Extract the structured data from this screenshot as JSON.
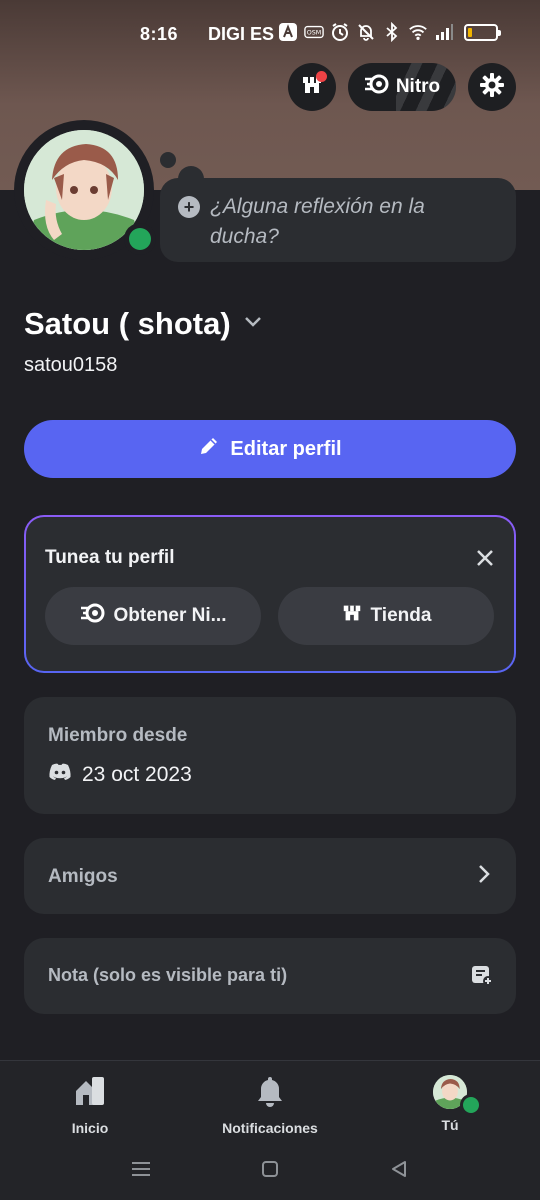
{
  "status_bar": {
    "time": "8:16",
    "carrier": "DIGI ES",
    "icons": [
      "app-a-icon",
      "osm-icon",
      "alarm-icon",
      "mute-icon",
      "bluetooth-icon",
      "wifi-icon",
      "signal-icon",
      "battery-icon"
    ]
  },
  "header": {
    "nitro_label": "Nitro",
    "icons": [
      "shop-icon",
      "nitro-icon",
      "gear-icon"
    ],
    "notification_color": "#ed4245"
  },
  "profile": {
    "display_name": "Satou ( shota)",
    "username": "satou0158",
    "status": "online",
    "status_color": "#23a55a",
    "thought_placeholder": "¿Alguna reflexión en la ducha?"
  },
  "edit_profile": {
    "label": "Editar perfil",
    "color": "#5865f2"
  },
  "tune_card": {
    "title": "Tunea tu perfil",
    "nitro_button": "Obtener Ni...",
    "shop_button": "Tienda"
  },
  "member_since": {
    "label": "Miembro desde",
    "date": "23 oct 2023"
  },
  "friends": {
    "label": "Amigos"
  },
  "note": {
    "label": "Nota (solo es visible para ti)"
  },
  "bottom_nav": {
    "items": [
      {
        "label": "Inicio",
        "icon": "home-icon"
      },
      {
        "label": "Notificaciones",
        "icon": "bell-icon"
      },
      {
        "label": "Tú",
        "icon": "avatar"
      }
    ]
  },
  "system_nav": [
    "menu-icon",
    "home-square-icon",
    "back-icon"
  ]
}
